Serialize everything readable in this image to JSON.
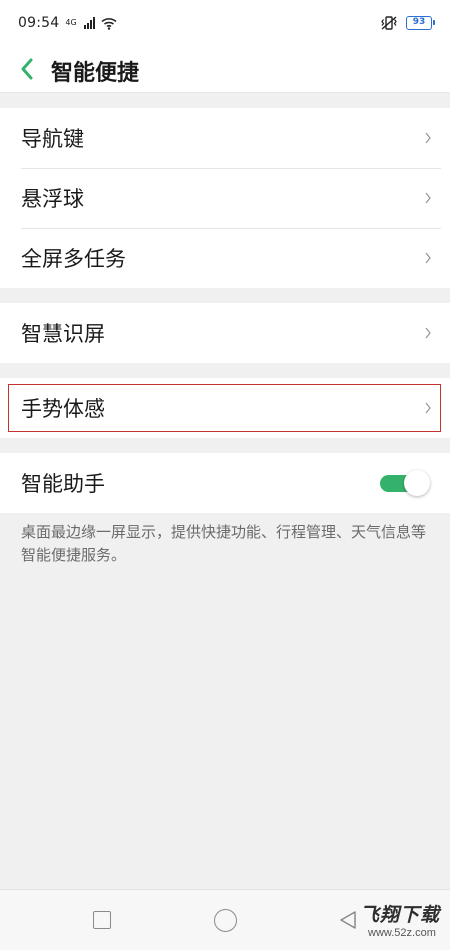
{
  "status_bar": {
    "time": "09:54",
    "signal_label": "4G",
    "battery": "93",
    "icons": [
      "signal-icon",
      "wifi-icon",
      "vibrate-icon",
      "battery-icon"
    ]
  },
  "header": {
    "back_icon": "chevron-left-icon",
    "title": "智能便捷"
  },
  "groups": [
    {
      "items": [
        {
          "label": "导航键"
        },
        {
          "label": "悬浮球"
        },
        {
          "label": "全屏多任务"
        }
      ]
    },
    {
      "items": [
        {
          "label": "智慧识屏"
        }
      ]
    },
    {
      "items": [
        {
          "label": "手势体感"
        }
      ]
    },
    {
      "items": [
        {
          "label": "智能助手",
          "toggle": true
        }
      ]
    }
  ],
  "description": "桌面最边缘一屏显示，提供快捷功能、行程管理、天气信息等智能便捷服务。",
  "colors": {
    "accent": "#34b26b",
    "highlight_border": "#c4322e",
    "battery": "#2a6fd4"
  },
  "nav_bar": {
    "icons": [
      "recents-square-icon",
      "home-circle-icon",
      "back-triangle-icon"
    ]
  },
  "watermark": {
    "main": "飞翔下载",
    "sub": "www.52z.com"
  }
}
